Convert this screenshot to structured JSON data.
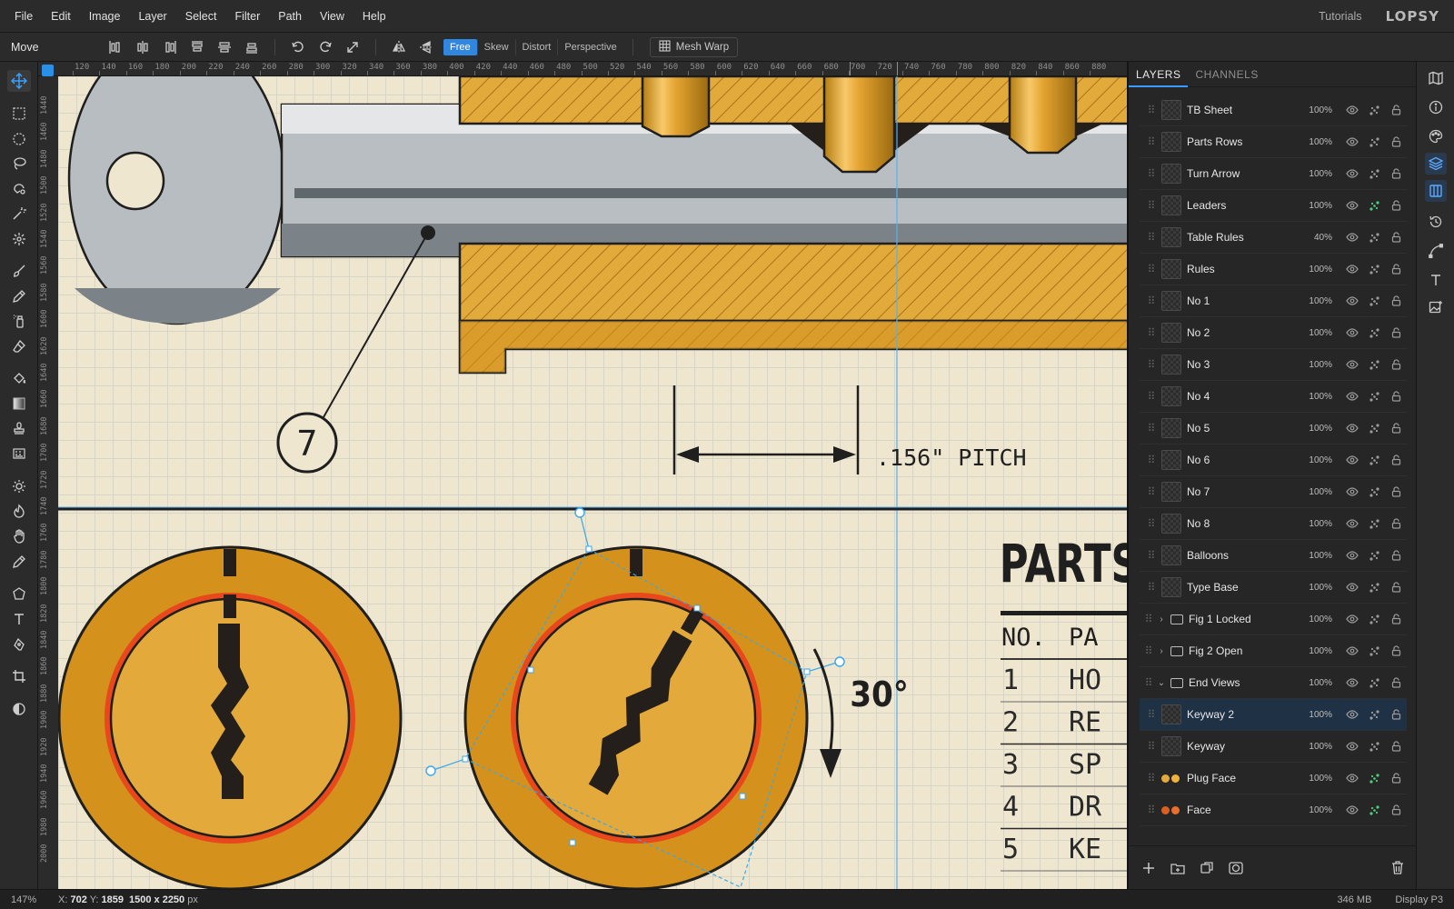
{
  "menubar": {
    "items": [
      "File",
      "Edit",
      "Image",
      "Layer",
      "Select",
      "Filter",
      "Path",
      "View",
      "Help"
    ],
    "tutorials": "Tutorials",
    "brand": "LOPSY"
  },
  "optbar": {
    "tool_name": "Move",
    "transform_modes": [
      "Free",
      "Skew",
      "Distort",
      "Perspective"
    ],
    "active_mode": "Free",
    "mesh_warp": "Mesh Warp"
  },
  "panel": {
    "tabs": [
      "LAYERS",
      "CHANNELS"
    ],
    "active_tab": "LAYERS",
    "layers": [
      {
        "name": "TB Sheet",
        "opacity": "100%",
        "fx": false
      },
      {
        "name": "Parts Rows",
        "opacity": "100%",
        "fx": false
      },
      {
        "name": "Turn Arrow",
        "opacity": "100%",
        "fx": false
      },
      {
        "name": "Leaders",
        "opacity": "100%",
        "fx": true
      },
      {
        "name": "Table Rules",
        "opacity": "40%",
        "fx": false
      },
      {
        "name": "Rules",
        "opacity": "100%",
        "fx": false
      },
      {
        "name": "No 1",
        "opacity": "100%",
        "fx": false
      },
      {
        "name": "No 2",
        "opacity": "100%",
        "fx": false
      },
      {
        "name": "No 3",
        "opacity": "100%",
        "fx": false
      },
      {
        "name": "No 4",
        "opacity": "100%",
        "fx": false
      },
      {
        "name": "No 5",
        "opacity": "100%",
        "fx": false
      },
      {
        "name": "No 6",
        "opacity": "100%",
        "fx": false
      },
      {
        "name": "No 7",
        "opacity": "100%",
        "fx": false
      },
      {
        "name": "No 8",
        "opacity": "100%",
        "fx": false
      },
      {
        "name": "Balloons",
        "opacity": "100%",
        "fx": false
      },
      {
        "name": "Type Base",
        "opacity": "100%",
        "fx": false
      },
      {
        "name": "Fig 1 Locked",
        "opacity": "100%",
        "fx": false,
        "group": true,
        "expanded": false
      },
      {
        "name": "Fig 2 Open",
        "opacity": "100%",
        "fx": false,
        "group": true,
        "expanded": false
      },
      {
        "name": "End Views",
        "opacity": "100%",
        "fx": false,
        "group": true,
        "expanded": true
      },
      {
        "name": "Keyway 2",
        "opacity": "100%",
        "fx": false,
        "selected": true
      },
      {
        "name": "Keyway",
        "opacity": "100%",
        "fx": false
      },
      {
        "name": "Plug Face",
        "opacity": "100%",
        "fx": true,
        "thumb": [
          "#e3a93a",
          "#f0b23c"
        ]
      },
      {
        "name": "Face",
        "opacity": "100%",
        "fx": true,
        "thumb": [
          "#d9601f",
          "#e8702a"
        ]
      }
    ]
  },
  "ruler": {
    "top_labels": [
      "120",
      "140",
      "160",
      "180",
      "200",
      "220",
      "240",
      "260",
      "280",
      "300",
      "320",
      "340",
      "360",
      "380",
      "400",
      "420",
      "440",
      "460",
      "480",
      "500",
      "520",
      "540",
      "560",
      "580",
      "600",
      "620",
      "640",
      "660",
      "680",
      "700",
      "720",
      "740",
      "760",
      "780",
      "800",
      "820",
      "840",
      "860",
      "880"
    ],
    "left_labels": [
      "1440",
      "1460",
      "1480",
      "1500",
      "1520",
      "1540",
      "1560",
      "1580",
      "1600",
      "1620",
      "1640",
      "1660",
      "1680",
      "1700",
      "1720",
      "1740",
      "1760",
      "1780",
      "1800",
      "1820",
      "1840",
      "1860",
      "1880",
      "1900",
      "1920",
      "1940",
      "1960",
      "1980",
      "2000"
    ]
  },
  "artwork": {
    "balloon_number": "7",
    "pitch_label": ".156\" PITCH",
    "rotation_label": "30°",
    "table_title": "PARTS",
    "table_header": [
      "NO.",
      "PA"
    ],
    "table_rows": [
      {
        "no": "1",
        "part": "HO"
      },
      {
        "no": "2",
        "part": "RE"
      },
      {
        "no": "3",
        "part": "SP"
      },
      {
        "no": "4",
        "part": "DR"
      },
      {
        "no": "5",
        "part": "KE"
      }
    ]
  },
  "status": {
    "zoom": "147%",
    "x_label": "X:",
    "x": "702",
    "y_label": "Y:",
    "y": "1859",
    "doc_size": "1500 x 2250",
    "doc_unit": "px",
    "memory": "346 MB",
    "color_profile": "Display P3"
  },
  "colors": {
    "accent": "#2f87e0",
    "canvas_paper": "#efe6cf",
    "brass": "#e3a93a",
    "brass_dark": "#d4921c",
    "face_red": "#e8481b",
    "steel": "#b9bec2"
  }
}
